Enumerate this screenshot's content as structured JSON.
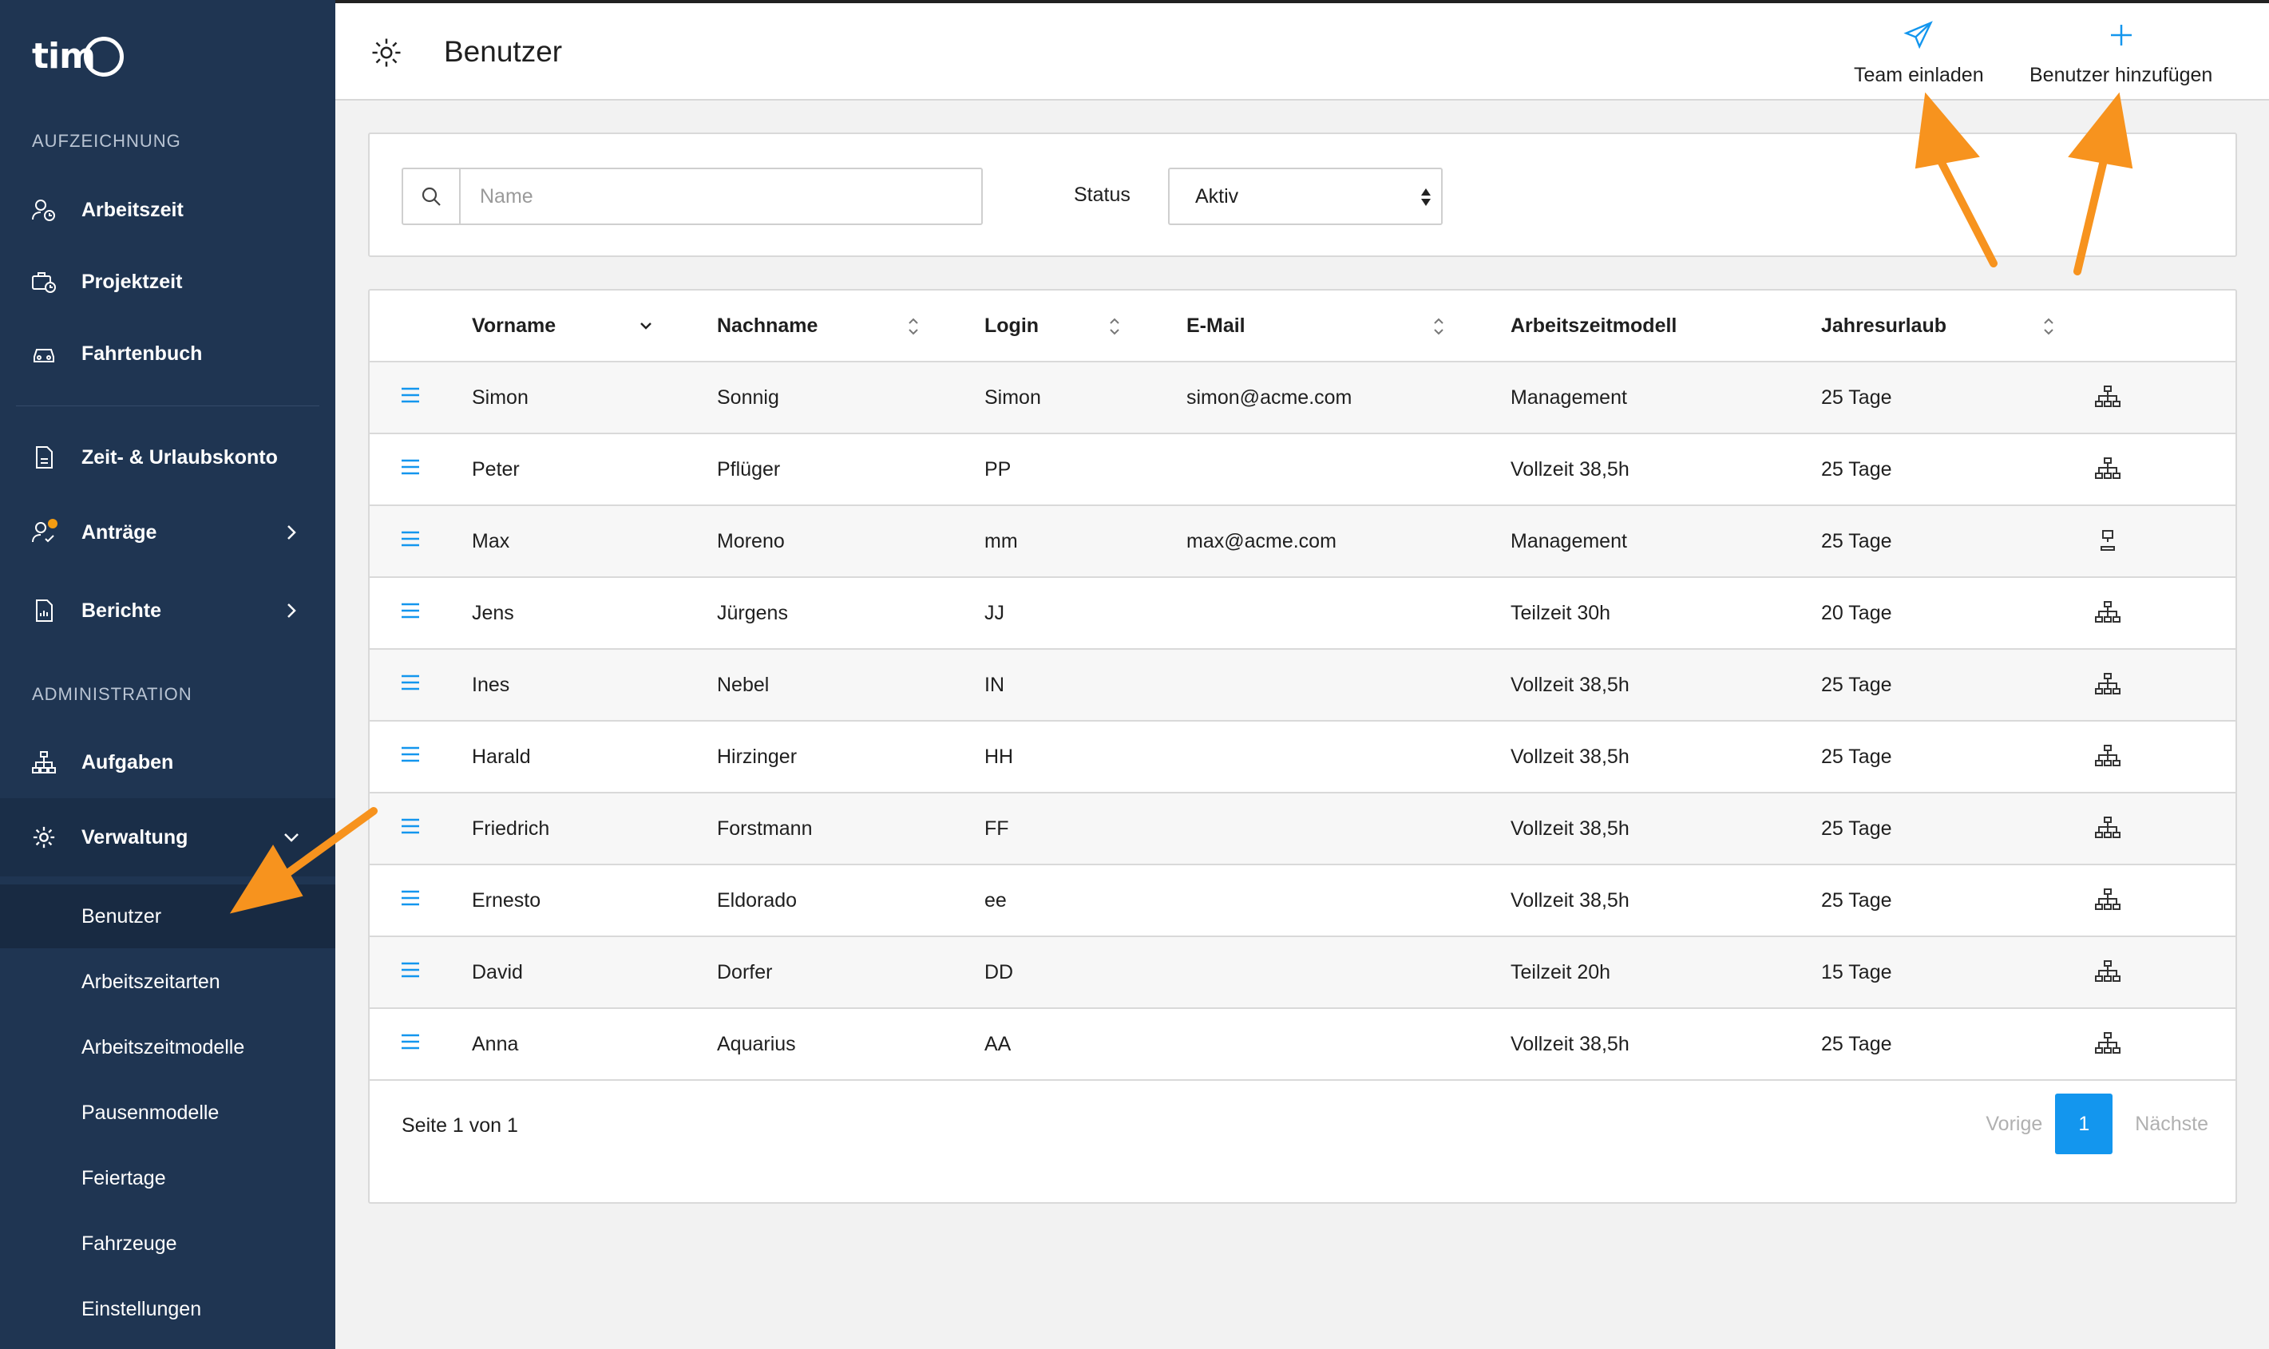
{
  "app": {
    "logo_text": "tim"
  },
  "sidebar": {
    "section_recording": "AUFZEICHNUNG",
    "section_admin": "ADMINISTRATION",
    "items": [
      {
        "label": "Arbeitszeit",
        "icon": "user-clock-icon"
      },
      {
        "label": "Projektzeit",
        "icon": "briefcase-clock-icon"
      },
      {
        "label": "Fahrtenbuch",
        "icon": "car-icon"
      },
      {
        "label": "Zeit- & Urlaubskonto",
        "icon": "document-icon"
      },
      {
        "label": "Anträge",
        "icon": "user-check-icon"
      },
      {
        "label": "Berichte",
        "icon": "report-icon"
      },
      {
        "label": "Aufgaben",
        "icon": "hierarchy-icon"
      },
      {
        "label": "Verwaltung",
        "icon": "gear-icon"
      }
    ],
    "sub_items": [
      {
        "label": "Benutzer"
      },
      {
        "label": "Arbeitszeitarten"
      },
      {
        "label": "Arbeitszeitmodelle"
      },
      {
        "label": "Pausenmodelle"
      },
      {
        "label": "Feiertage"
      },
      {
        "label": "Fahrzeuge"
      },
      {
        "label": "Einstellungen"
      }
    ]
  },
  "header": {
    "title": "Benutzer",
    "invite_label": "Team einladen",
    "add_label": "Benutzer hinzufügen"
  },
  "filter": {
    "search_placeholder": "Name",
    "search_value": "",
    "status_label": "Status",
    "status_value": "Aktiv"
  },
  "table": {
    "columns": [
      "Vorname",
      "Nachname",
      "Login",
      "E-Mail",
      "Arbeitszeitmodell",
      "Jahresurlaub"
    ],
    "rows": [
      {
        "first": "Simon",
        "last": "Sonnig",
        "login": "Simon",
        "email": "simon@acme.com",
        "model": "Management",
        "vacation": "25 Tage",
        "icon": "hierarchy-icon"
      },
      {
        "first": "Peter",
        "last": "Pflüger",
        "login": "PP",
        "email": "",
        "model": "Vollzeit 38,5h",
        "vacation": "25 Tage",
        "icon": "hierarchy-icon"
      },
      {
        "first": "Max",
        "last": "Moreno",
        "login": "mm",
        "email": "max@acme.com",
        "model": "Management",
        "vacation": "25 Tage",
        "icon": "single-node-icon"
      },
      {
        "first": "Jens",
        "last": "Jürgens",
        "login": "JJ",
        "email": "",
        "model": "Teilzeit 30h",
        "vacation": "20 Tage",
        "icon": "hierarchy-icon"
      },
      {
        "first": "Ines",
        "last": "Nebel",
        "login": "IN",
        "email": "",
        "model": "Vollzeit 38,5h",
        "vacation": "25 Tage",
        "icon": "hierarchy-icon"
      },
      {
        "first": "Harald",
        "last": "Hirzinger",
        "login": "HH",
        "email": "",
        "model": "Vollzeit 38,5h",
        "vacation": "25 Tage",
        "icon": "hierarchy-icon"
      },
      {
        "first": "Friedrich",
        "last": "Forstmann",
        "login": "FF",
        "email": "",
        "model": "Vollzeit 38,5h",
        "vacation": "25 Tage",
        "icon": "hierarchy-icon"
      },
      {
        "first": "Ernesto",
        "last": "Eldorado",
        "login": "ee",
        "email": "",
        "model": "Vollzeit 38,5h",
        "vacation": "25 Tage",
        "icon": "hierarchy-icon"
      },
      {
        "first": "David",
        "last": "Dorfer",
        "login": "DD",
        "email": "",
        "model": "Teilzeit 20h",
        "vacation": "15 Tage",
        "icon": "hierarchy-icon"
      },
      {
        "first": "Anna",
        "last": "Aquarius",
        "login": "AA",
        "email": "",
        "model": "Vollzeit 38,5h",
        "vacation": "25 Tage",
        "icon": "hierarchy-icon"
      }
    ],
    "footer": "Seite 1 von 1",
    "pager": {
      "prev": "Vorige",
      "current": "1",
      "next": "Nächste"
    }
  },
  "colors": {
    "sidebar_bg": "#1f3552",
    "accent_blue": "#1396ee",
    "annotation_orange": "#f7931e",
    "notification_dot": "#f39c12"
  }
}
